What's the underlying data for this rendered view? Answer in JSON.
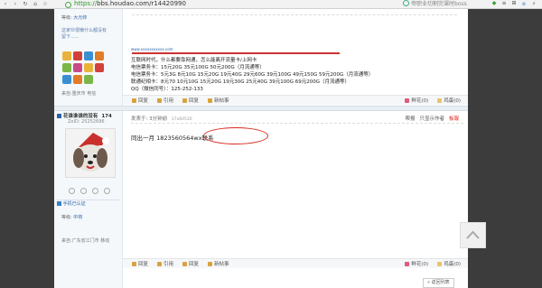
{
  "browser": {
    "url_prefix": "https://",
    "url_host": "bbs.houdao.com",
    "url_path": "/r14420990",
    "search_placeholder": "帝职业切割完课时boss"
  },
  "post1": {
    "user": {
      "level_label": "等级:",
      "level_value": "大元帅",
      "sig_line1": "这家伙很懒什么都没有",
      "sig_line2": "留下......",
      "from": "来自:重庆市 电信"
    },
    "content": {
      "link_text": "www.xxxxxxxxxxx.com",
      "line1": "互联网时代，什么都要靠网通，怎么能离开流量卡/上网卡",
      "line2": "电信票务卡：15元20G 35元100G 50元200G（月流通等）",
      "line3": "电信票务卡：5元3G 8元10G 15元20G 19元40G 29元60G 39元100G 49元150G 59元200G（月流通等）",
      "line4": "联通纪相卡：8元70 10元10G 15元20G 19元30G 25元40G 39元100G 69元200G（月流通等）",
      "line5": "QQ（微信同号）：125-252-133"
    },
    "actions": {
      "report": "回复",
      "quote": "引用",
      "reply": "回复",
      "new_post": "新帖事",
      "flower": "鲜花(0)",
      "egg": "鸡蛋(0)"
    }
  },
  "post2": {
    "user": {
      "name": "花谁谁谁的没有",
      "floor": "174",
      "uid": "ZoID: 25252696",
      "verify": "手机已认证",
      "level_label": "等级:",
      "level_value": "中将",
      "from": "来自:广东省江门市 移动"
    },
    "meta": {
      "posted": "发表于: 3分钟前",
      "ip": "17x60530",
      "help": "帮报",
      "only_author": "只显示作者",
      "floor_tag": "板報"
    },
    "content": {
      "text": "同出一月 1823560564wx联系"
    },
    "actions": {
      "reply": "回复",
      "quote": "引用",
      "reply2": "回复",
      "new_post": "新帖事",
      "flower": "鲜花(0)",
      "egg": "鸡蛋(0)"
    }
  },
  "footer": {
    "back_to_list": "返回列表"
  },
  "colors": {
    "outer_bg": "#3c3c3c",
    "highlight_circle": "#d9281e",
    "level_link": "#2b61a5",
    "action_icon": "#d8a23c"
  }
}
